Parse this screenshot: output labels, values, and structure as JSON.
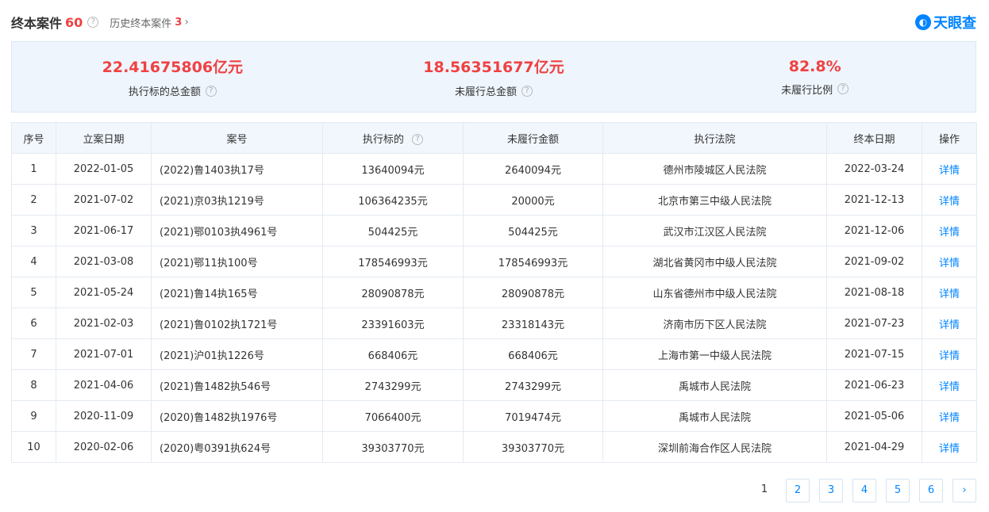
{
  "header": {
    "title": "终本案件",
    "count": "60",
    "history_label": "历史终本案件",
    "history_count": "3",
    "logo_text": "天眼查"
  },
  "summary": [
    {
      "value": "22.41675806亿元",
      "label": "执行标的总金额"
    },
    {
      "value": "18.56351677亿元",
      "label": "未履行总金额"
    },
    {
      "value": "82.8%",
      "label": "未履行比例"
    }
  ],
  "table": {
    "headers": [
      "序号",
      "立案日期",
      "案号",
      "执行标的",
      "未履行金额",
      "执行法院",
      "终本日期",
      "操作"
    ],
    "rows": [
      [
        "1",
        "2022-01-05",
        "(2022)鲁1403执17号",
        "13640094元",
        "2640094元",
        "德州市陵城区人民法院",
        "2022-03-24",
        "详情"
      ],
      [
        "2",
        "2021-07-02",
        "(2021)京03执1219号",
        "106364235元",
        "20000元",
        "北京市第三中级人民法院",
        "2021-12-13",
        "详情"
      ],
      [
        "3",
        "2021-06-17",
        "(2021)鄂0103执4961号",
        "504425元",
        "504425元",
        "武汉市江汉区人民法院",
        "2021-12-06",
        "详情"
      ],
      [
        "4",
        "2021-03-08",
        "(2021)鄂11执100号",
        "178546993元",
        "178546993元",
        "湖北省黄冈市中级人民法院",
        "2021-09-02",
        "详情"
      ],
      [
        "5",
        "2021-05-24",
        "(2021)鲁14执165号",
        "28090878元",
        "28090878元",
        "山东省德州市中级人民法院",
        "2021-08-18",
        "详情"
      ],
      [
        "6",
        "2021-02-03",
        "(2021)鲁0102执1721号",
        "23391603元",
        "23318143元",
        "济南市历下区人民法院",
        "2021-07-23",
        "详情"
      ],
      [
        "7",
        "2021-07-01",
        "(2021)沪01执1226号",
        "668406元",
        "668406元",
        "上海市第一中级人民法院",
        "2021-07-15",
        "详情"
      ],
      [
        "8",
        "2021-04-06",
        "(2021)鲁1482执546号",
        "2743299元",
        "2743299元",
        "禹城市人民法院",
        "2021-06-23",
        "详情"
      ],
      [
        "9",
        "2020-11-09",
        "(2020)鲁1482执1976号",
        "7066400元",
        "7019474元",
        "禹城市人民法院",
        "2021-05-06",
        "详情"
      ],
      [
        "10",
        "2020-02-06",
        "(2020)粤0391执624号",
        "39303770元",
        "39303770元",
        "深圳前海合作区人民法院",
        "2021-04-29",
        "详情"
      ]
    ]
  },
  "pagination": {
    "pages": [
      "1",
      "2",
      "3",
      "4",
      "5",
      "6"
    ],
    "current": "1",
    "next_icon": "chevron-right-icon"
  },
  "colors": {
    "accent": "#0084ff",
    "highlight": "#f04142"
  }
}
